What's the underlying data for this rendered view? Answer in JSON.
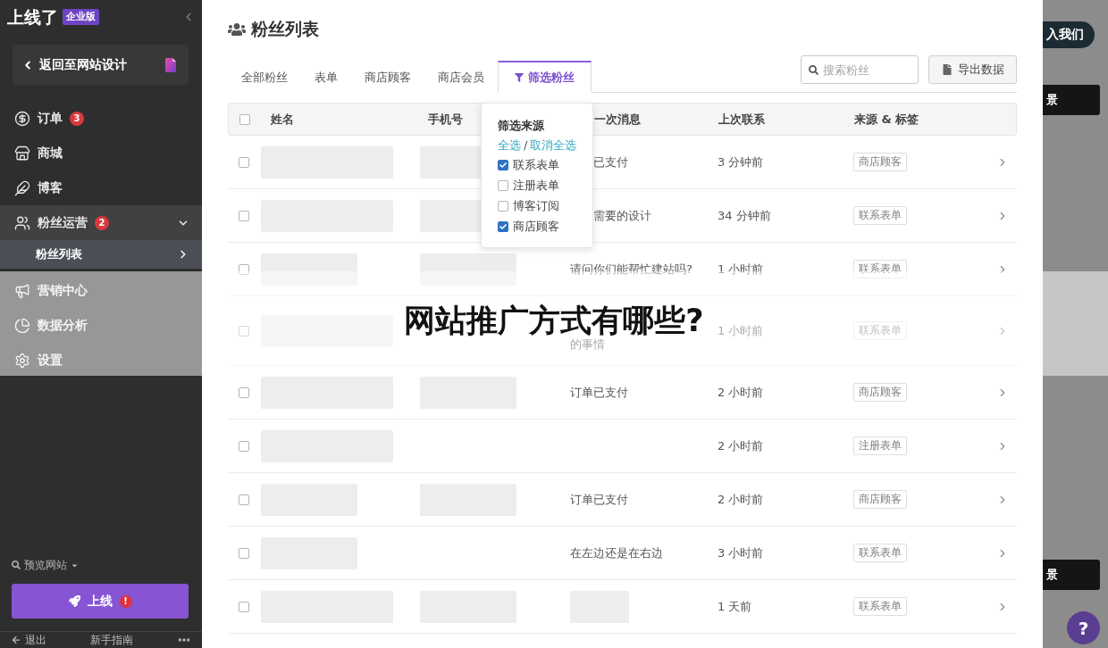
{
  "sidebar": {
    "logo": "上线了",
    "edition_badge": "企业版",
    "back_button": "返回至网站设计",
    "menu": [
      {
        "label": "订单",
        "badge": "3",
        "selected": false,
        "expanded": false
      },
      {
        "label": "商城",
        "selected": false,
        "expanded": false
      },
      {
        "label": "博客",
        "selected": false,
        "expanded": false
      },
      {
        "label": "粉丝运营",
        "badge": "2",
        "selected": false,
        "expanded": true,
        "children": [
          {
            "label": "粉丝列表",
            "selected": true
          }
        ]
      },
      {
        "label": "营销中心",
        "selected": false,
        "expanded": false
      },
      {
        "label": "数据分析",
        "selected": false,
        "expanded": false
      },
      {
        "label": "设置",
        "selected": false,
        "expanded": false
      }
    ],
    "preview_menu": "预览网站",
    "publish_button": {
      "label": "上线",
      "alert": "!"
    },
    "footer": [
      {
        "label": "退出"
      },
      {
        "label": "新手指南"
      }
    ]
  },
  "main": {
    "title": "粉丝列表",
    "tabs": [
      {
        "label": "全部粉丝",
        "kind": "plain",
        "selected": false
      },
      {
        "label": "表单",
        "kind": "plain",
        "selected": false
      },
      {
        "label": "商店顾客",
        "kind": "plain",
        "selected": false
      },
      {
        "label": "商店会员",
        "kind": "plain",
        "selected": false
      },
      {
        "label": "筛选粉丝",
        "kind": "filter",
        "selected": true
      }
    ],
    "search": {
      "placeholder": "搜索粉丝"
    },
    "export_button": "导出数据"
  },
  "table": {
    "header_checkbox": {
      "checked": false
    },
    "columns": [
      "姓名",
      "手机号",
      "一次消息",
      "上次联系",
      "来源 & 标签"
    ],
    "rows": [
      {
        "kind": "normal",
        "checked": false,
        "name_block_wide": true,
        "phone_block": true,
        "message": "已支付",
        "message_block": false,
        "last_contact": "3 分钟前",
        "tag": "商店顾客"
      },
      {
        "kind": "normal",
        "checked": false,
        "name_block_wide": true,
        "phone_block": true,
        "message": "需要的设计",
        "message_block": false,
        "last_contact": "34 分钟前",
        "tag": "联系表单"
      },
      {
        "kind": "normal",
        "checked": false,
        "name_block_wide": false,
        "phone_block": true,
        "message": "请问你们能帮忙建站吗?",
        "message_block": false,
        "last_contact": "1 小时前",
        "tag": "联系表单"
      },
      {
        "kind": "tall",
        "checked": false,
        "name_block_wide": true,
        "phone_block": false,
        "message": "的事情",
        "message_block": false,
        "last_contact": "1 小时前",
        "tag": "联系表单"
      },
      {
        "kind": "normal",
        "checked": false,
        "name_block_wide": true,
        "phone_block": true,
        "message": "订单已支付",
        "message_block": false,
        "last_contact": "2 小时前",
        "tag": "商店顾客"
      },
      {
        "kind": "normal",
        "checked": false,
        "name_block_wide": true,
        "phone_block": false,
        "message_block": false,
        "last_contact": "2 小时前",
        "tag": "注册表单"
      },
      {
        "kind": "normal",
        "checked": false,
        "name_block_wide": false,
        "phone_block": true,
        "message": "订单已支付",
        "message_block": false,
        "last_contact": "2 小时前",
        "tag": "商店顾客"
      },
      {
        "kind": "normal",
        "checked": false,
        "name_block_wide": false,
        "phone_block": false,
        "message": "在左边还是在右边",
        "message_block": false,
        "last_contact": "3 小时前",
        "tag": "联系表单"
      },
      {
        "kind": "normal",
        "checked": false,
        "name_block_wide": true,
        "phone_block": true,
        "message_block": true,
        "last_contact": "1 天前",
        "tag": "联系表单"
      }
    ]
  },
  "filter_popup": {
    "title": "筛选来源",
    "select_all": "全选",
    "separator": "/",
    "deselect_all": "取消全选",
    "options": [
      {
        "label": "联系表单",
        "checked": true
      },
      {
        "label": "注册表单",
        "checked": false
      },
      {
        "label": "博客订阅",
        "checked": false
      },
      {
        "label": "商店顾客",
        "checked": true
      }
    ]
  },
  "background": {
    "join_button": "入我们",
    "dark_buttons": [
      "景",
      "景"
    ],
    "help_button": "?"
  },
  "caption_banner": {
    "text": "网站推广方式有哪些?"
  }
}
